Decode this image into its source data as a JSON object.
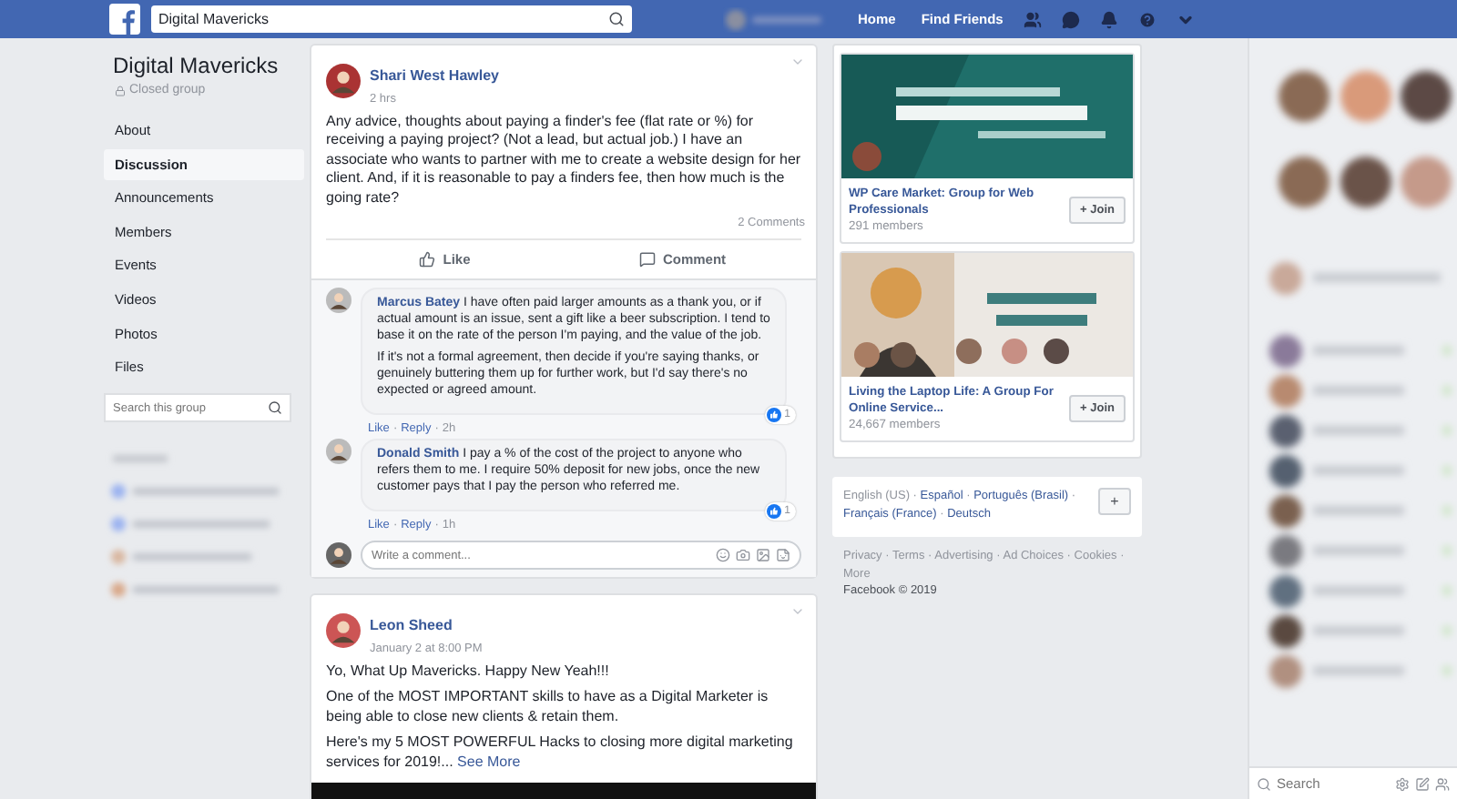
{
  "topbar": {
    "search_value": "Digital Mavericks",
    "links": [
      "Home",
      "Find Friends"
    ]
  },
  "sidebar": {
    "group_name": "Digital Mavericks",
    "privacy": "Closed group",
    "items": [
      {
        "label": "About",
        "selected": false
      },
      {
        "label": "Discussion",
        "selected": true
      },
      {
        "label": "Announcements",
        "selected": false
      },
      {
        "label": "Members",
        "selected": false
      },
      {
        "label": "Events",
        "selected": false
      },
      {
        "label": "Videos",
        "selected": false
      },
      {
        "label": "Photos",
        "selected": false
      },
      {
        "label": "Files",
        "selected": false
      }
    ],
    "search_placeholder": "Search this group"
  },
  "separator": "·",
  "posts": [
    {
      "author": "Shari West Hawley",
      "time": "2 hrs",
      "paragraphs": [
        "Any advice, thoughts about paying a finder's fee (flat rate or %) for receiving a paying project? (Not a lead, but actual job.) I have an associate who wants to partner with me to create a website design for her client. And, if it is reasonable to pay a finders fee, then how much is the going rate?"
      ],
      "comment_count": "2 Comments",
      "actions": [
        "Like",
        "Comment"
      ],
      "comments": [
        {
          "author": "Marcus Batey",
          "paragraphs": [
            "I have often paid larger amounts as a thank you, or if actual amount is an issue, sent a gift like a beer subscription. I tend to base it on the rate of the person I'm paying, and the value of the job.",
            "If it's not a formal agreement, then decide if you're saying thanks, or genuinely buttering them up for further work, but I'd say there's no expected or agreed amount."
          ],
          "links": [
            "Like",
            "Reply"
          ],
          "time": "2h",
          "reactions": "1"
        },
        {
          "author": "Donald Smith",
          "paragraphs": [
            "I pay a % of the cost of the project to anyone who refers them to me. I require 50% deposit for new jobs, once the new customer pays that I pay the person who referred me."
          ],
          "links": [
            "Like",
            "Reply"
          ],
          "time": "1h",
          "reactions": "1"
        }
      ],
      "comment_placeholder": "Write a comment..."
    },
    {
      "author": "Leon Sheed",
      "time": "January 2 at 8:00 PM",
      "paragraphs": [
        "Yo, What Up Mavericks. Happy New Yeah!!!",
        "One of the MOST IMPORTANT skills to have as a Digital Marketer is being able to close new clients & retain them.",
        "Here's my 5 MOST POWERFUL Hacks to closing more digital marketing services for 2019!..."
      ],
      "see_more": "See More"
    }
  ],
  "suggested_groups": [
    {
      "name": "WP Care Market: Group for Web Professionals",
      "members": "291 members",
      "button": "+ Join",
      "kind": "teal"
    },
    {
      "name": "Living the Laptop Life: A Group For Online Service...",
      "members": "24,667 members",
      "button": "+ Join",
      "kind": "light"
    }
  ],
  "languages": [
    {
      "label": "English (US)",
      "selected": true
    },
    {
      "label": "Español",
      "selected": false
    },
    {
      "label": "Português (Brasil)",
      "selected": false
    },
    {
      "label": "Français (France)",
      "selected": false
    },
    {
      "label": "Deutsch",
      "selected": false
    }
  ],
  "language_add": "+",
  "footer_links": [
    "Privacy",
    "Terms",
    "Advertising",
    "Ad Choices",
    "Cookies",
    "More"
  ],
  "copyright": "Facebook © 2019",
  "chat": {
    "search_placeholder": "Search"
  }
}
